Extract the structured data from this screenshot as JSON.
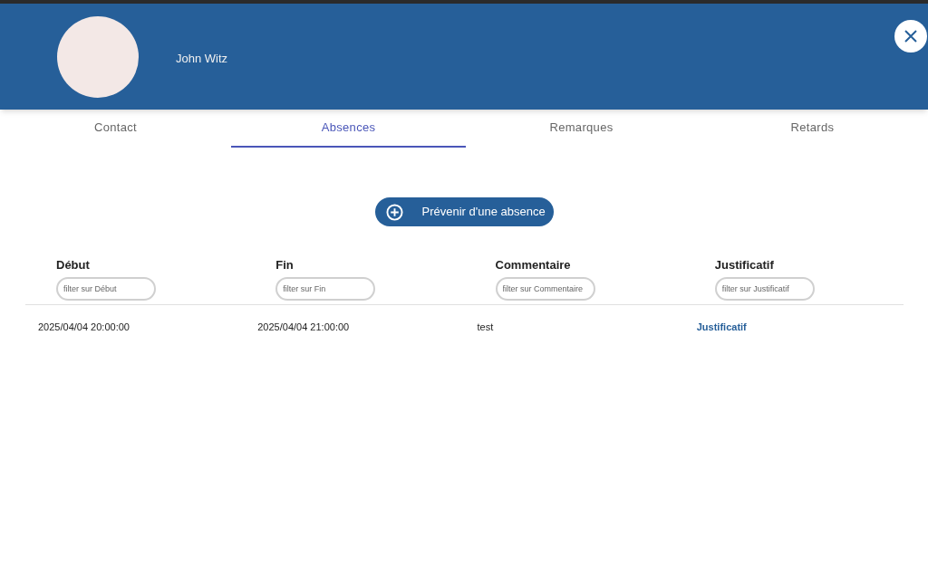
{
  "header": {
    "name": "John Witz"
  },
  "tabs": [
    {
      "label": "Contact",
      "selected": false
    },
    {
      "label": "Absences",
      "selected": true
    },
    {
      "label": "Remarques",
      "selected": false
    },
    {
      "label": "Retards",
      "selected": false
    }
  ],
  "action_button": {
    "label": "Prévenir d'une absence"
  },
  "table": {
    "columns": [
      {
        "label": "Début",
        "placeholder": "filter sur Début"
      },
      {
        "label": "Fin",
        "placeholder": "filter sur Fin"
      },
      {
        "label": "Commentaire",
        "placeholder": "filter sur Commentaire"
      },
      {
        "label": "Justificatif",
        "placeholder": "filter sur Justificatif"
      }
    ],
    "rows": [
      {
        "cells": [
          {
            "kind": "text",
            "text": "2025/04/04 20:00:00"
          },
          {
            "kind": "text",
            "text": "2025/04/04 21:00:00"
          },
          {
            "kind": "text",
            "text": "test"
          },
          {
            "kind": "link",
            "text": "Justificatif"
          }
        ]
      }
    ]
  }
}
